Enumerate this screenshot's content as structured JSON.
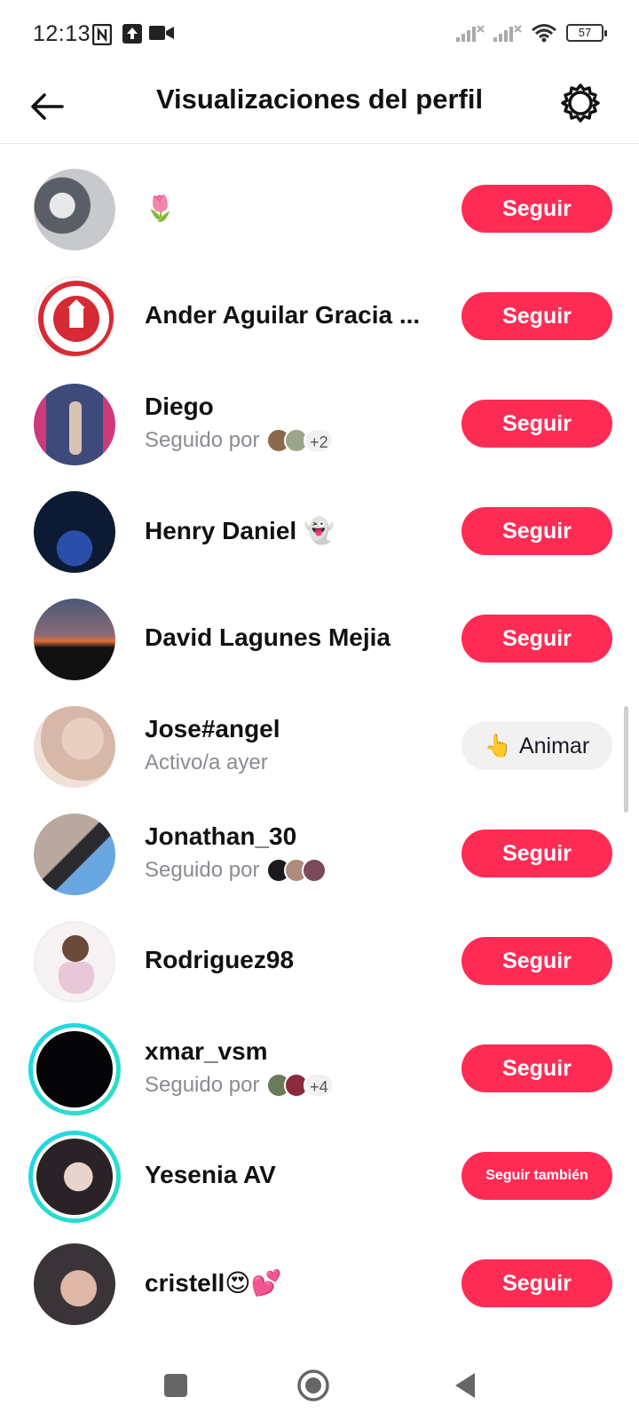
{
  "status_bar": {
    "time": "12:13",
    "icons": [
      "nfc-icon",
      "upload-icon",
      "video-camera-icon",
      "signal-icon",
      "signal-icon",
      "wifi-icon"
    ],
    "battery": "57"
  },
  "header": {
    "title": "Visualizaciones del perfil",
    "back_icon": "arrow-left-icon",
    "settings_icon": "gear-icon"
  },
  "rows": [
    {
      "name": "🌷",
      "sub": "",
      "button": "Seguir",
      "avatar_color": "#6b6e76"
    },
    {
      "name": "Ander Aguilar  Gracia ...",
      "sub": "",
      "button": "Seguir",
      "avatar_color": "#d62a34"
    },
    {
      "name": "Diego",
      "sub": "Seguido por",
      "mini_count": "+2",
      "button": "Seguir",
      "avatar_color": "#3d4a7a"
    },
    {
      "name": "Henry Daniel 👻",
      "sub": "",
      "button": "Seguir",
      "avatar_color": "#0d1a33"
    },
    {
      "name": "David Lagunes Mejia",
      "sub": "",
      "button": "Seguir",
      "avatar_color": "#3b2a3a"
    },
    {
      "name": "Jose#angel",
      "sub": "Activo/a ayer",
      "button": "Animar",
      "button_icon": "👆",
      "avatar_color": "#d7b7a8"
    },
    {
      "name": "Jonathan_30",
      "sub": "Seguido por",
      "mini_count": "",
      "button": "Seguir",
      "avatar_color": "#8e8a88"
    },
    {
      "name": "Rodriguez98",
      "sub": "",
      "button": "Seguir",
      "avatar_color": "#efe6ea"
    },
    {
      "name": "xmar_vsm",
      "sub": "Seguido por",
      "mini_count": "+4",
      "button": "Seguir",
      "avatar_color": "#050508"
    },
    {
      "name": "Yesenia AV",
      "sub": "",
      "button": "Seguir también",
      "avatar_color": "#c9c3c6"
    },
    {
      "name": "cristell😍💕",
      "sub": "",
      "button": "Seguir",
      "avatar_color": "#3a3438"
    }
  ],
  "colors": {
    "accent": "#fe2c55",
    "ring": "#20d5ec",
    "secondary_text": "#8a8b91"
  },
  "navbar": {
    "icons": [
      "square-recents-icon",
      "circle-home-icon",
      "triangle-back-icon"
    ]
  }
}
